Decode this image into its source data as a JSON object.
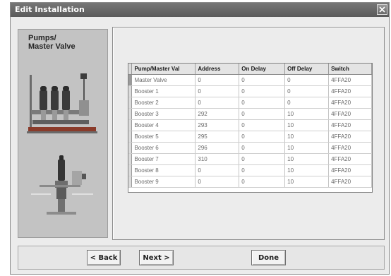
{
  "window": {
    "title": "Edit Installation",
    "close_label": "close"
  },
  "panel": {
    "title_line1": "Pumps/",
    "title_line2": "Master Valve"
  },
  "table": {
    "columns": [
      "Pump/Master Val",
      "Address",
      "On Delay",
      "Off Delay",
      "Switch"
    ],
    "rows": [
      [
        "Master Valve",
        "0",
        "0",
        "0",
        "4FFA20"
      ],
      [
        "Booster 1",
        "0",
        "0",
        "0",
        "4FFA20"
      ],
      [
        "Booster 2",
        "0",
        "0",
        "0",
        "4FFA20"
      ],
      [
        "Booster 3",
        "292",
        "0",
        "10",
        "4FFA20"
      ],
      [
        "Booster 4",
        "293",
        "0",
        "10",
        "4FFA20"
      ],
      [
        "Booster 5",
        "295",
        "0",
        "10",
        "4FFA20"
      ],
      [
        "Booster 6",
        "296",
        "0",
        "10",
        "4FFA20"
      ],
      [
        "Booster 7",
        "310",
        "0",
        "10",
        "4FFA20"
      ],
      [
        "Booster 8",
        "0",
        "0",
        "10",
        "4FFA20"
      ],
      [
        "Booster 9",
        "0",
        "0",
        "10",
        "4FFA20"
      ]
    ]
  },
  "buttons": {
    "back": "< Back",
    "next": "Next >",
    "done": "Done"
  }
}
